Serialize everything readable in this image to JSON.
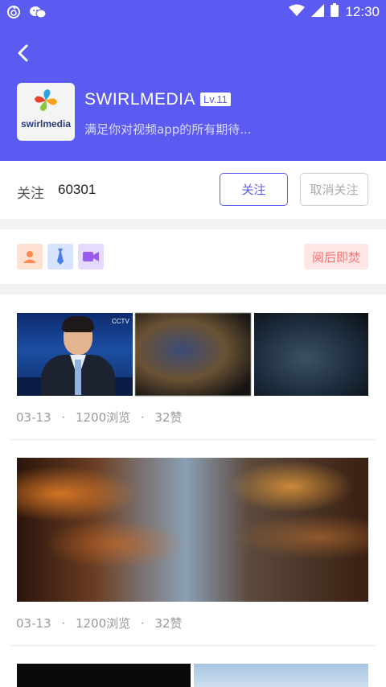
{
  "status_bar": {
    "time": "12:30"
  },
  "profile": {
    "name": "SWIRLMEDIA",
    "level": "Lv.11",
    "description": "满足你对视频app的所有期待...",
    "logo_text": "swirlmedia"
  },
  "follow": {
    "label": "关注",
    "count": "60301",
    "follow_button": "关注",
    "unfollow_button": "取消关注"
  },
  "tags": {
    "icons": [
      "user-icon",
      "tie-icon",
      "video-camera-icon"
    ],
    "burn_after_reading": "阅后即焚"
  },
  "posts": [
    {
      "date": "03-13",
      "views": "1200浏览",
      "likes": "32赞",
      "sep": "·"
    },
    {
      "date": "03-13",
      "views": "1200浏览",
      "likes": "32赞",
      "sep": "·"
    }
  ],
  "colors": {
    "header_bg": "#5b5bf2",
    "accent": "#5b5bf2",
    "burn_bg": "#ffe6e6",
    "burn_text": "#ff6f6f"
  }
}
